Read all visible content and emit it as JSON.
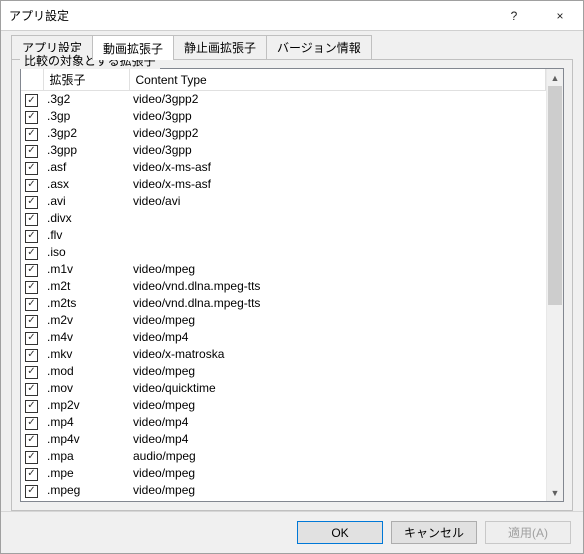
{
  "window": {
    "title": "アプリ設定",
    "help_tooltip": "?",
    "close_tooltip": "×"
  },
  "tabs": [
    {
      "label": "アプリ設定"
    },
    {
      "label": "動画拡張子"
    },
    {
      "label": "静止画拡張子"
    },
    {
      "label": "バージョン情報"
    }
  ],
  "active_tab_index": 1,
  "group": {
    "legend": "比較の対象とする拡張子"
  },
  "columns": {
    "ext": "拡張子",
    "content_type": "Content Type"
  },
  "rows": [
    {
      "checked": true,
      "ext": ".3g2",
      "ct": "video/3gpp2"
    },
    {
      "checked": true,
      "ext": ".3gp",
      "ct": "video/3gpp"
    },
    {
      "checked": true,
      "ext": ".3gp2",
      "ct": "video/3gpp2"
    },
    {
      "checked": true,
      "ext": ".3gpp",
      "ct": "video/3gpp"
    },
    {
      "checked": true,
      "ext": ".asf",
      "ct": "video/x-ms-asf"
    },
    {
      "checked": true,
      "ext": ".asx",
      "ct": "video/x-ms-asf"
    },
    {
      "checked": true,
      "ext": ".avi",
      "ct": "video/avi"
    },
    {
      "checked": true,
      "ext": ".divx",
      "ct": ""
    },
    {
      "checked": true,
      "ext": ".flv",
      "ct": ""
    },
    {
      "checked": true,
      "ext": ".iso",
      "ct": ""
    },
    {
      "checked": true,
      "ext": ".m1v",
      "ct": "video/mpeg"
    },
    {
      "checked": true,
      "ext": ".m2t",
      "ct": "video/vnd.dlna.mpeg-tts"
    },
    {
      "checked": true,
      "ext": ".m2ts",
      "ct": "video/vnd.dlna.mpeg-tts"
    },
    {
      "checked": true,
      "ext": ".m2v",
      "ct": "video/mpeg"
    },
    {
      "checked": true,
      "ext": ".m4v",
      "ct": "video/mp4"
    },
    {
      "checked": true,
      "ext": ".mkv",
      "ct": "video/x-matroska"
    },
    {
      "checked": true,
      "ext": ".mod",
      "ct": "video/mpeg"
    },
    {
      "checked": true,
      "ext": ".mov",
      "ct": "video/quicktime"
    },
    {
      "checked": true,
      "ext": ".mp2v",
      "ct": "video/mpeg"
    },
    {
      "checked": true,
      "ext": ".mp4",
      "ct": "video/mp4"
    },
    {
      "checked": true,
      "ext": ".mp4v",
      "ct": "video/mp4"
    },
    {
      "checked": true,
      "ext": ".mpa",
      "ct": "audio/mpeg"
    },
    {
      "checked": true,
      "ext": ".mpe",
      "ct": "video/mpeg"
    },
    {
      "checked": true,
      "ext": ".mpeg",
      "ct": "video/mpeg"
    }
  ],
  "buttons": {
    "ok": "OK",
    "cancel": "キャンセル",
    "apply": "適用(A)"
  }
}
